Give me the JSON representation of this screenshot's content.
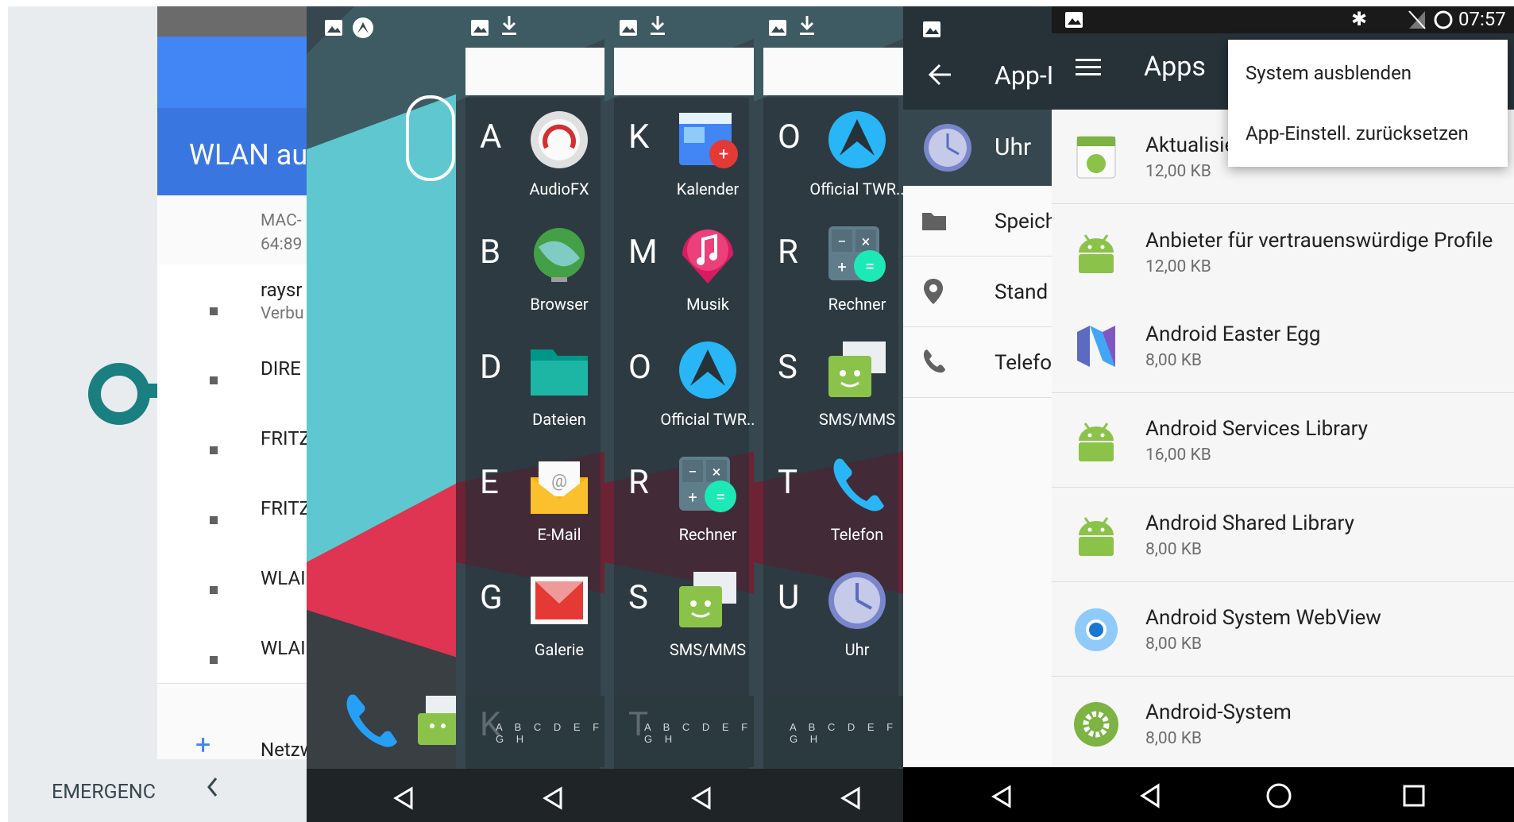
{
  "status_bar": {
    "time": "07:57"
  },
  "lock_panel": {
    "emergency": "EMERGENC",
    "wlan_title": "WLAN au",
    "mac_line1": "MAC-",
    "mac_line2": "64:89",
    "networks": [
      {
        "name": "raysr",
        "sub": "Verbu"
      },
      {
        "name": "DIRE",
        "sub": ""
      },
      {
        "name": "FRITZ",
        "sub": ""
      },
      {
        "name": "FRITZ",
        "sub": ""
      },
      {
        "name": "WLAI",
        "sub": ""
      },
      {
        "name": "WLAI",
        "sub": ""
      }
    ],
    "add_network": "Netzw"
  },
  "drawer_a": {
    "apps": [
      {
        "letter": "A",
        "name": "AudioFX"
      },
      {
        "letter": "B",
        "name": "Browser"
      },
      {
        "letter": "D",
        "name": "Dateien"
      },
      {
        "letter": "E",
        "name": "E-Mail"
      },
      {
        "letter": "G",
        "name": "Galerie"
      }
    ],
    "faded_letter": "K",
    "index": "A B C D E F G H"
  },
  "drawer_b": {
    "apps": [
      {
        "letter": "K",
        "name": "Kalender"
      },
      {
        "letter": "M",
        "name": "Musik"
      },
      {
        "letter": "O",
        "name": "Official TWR.."
      },
      {
        "letter": "R",
        "name": "Rechner"
      },
      {
        "letter": "S",
        "name": "SMS/MMS"
      }
    ],
    "faded_letter": "T",
    "index": "A B C D E F G H"
  },
  "drawer_c": {
    "apps": [
      {
        "letter": "O",
        "name": "Official TWR.."
      },
      {
        "letter": "R",
        "name": "Rechner"
      },
      {
        "letter": "S",
        "name": "SMS/MMS"
      },
      {
        "letter": "T",
        "name": "Telefon"
      },
      {
        "letter": "U",
        "name": "Uhr"
      }
    ],
    "index": "A B C D E F G H"
  },
  "app_info": {
    "title": "App-I",
    "app_name": "Uhr",
    "items": [
      "Speich",
      "Stand",
      "Telefo"
    ]
  },
  "apps_screen": {
    "title": "Apps",
    "menu": [
      "System ausblenden",
      "App-Einstell. zurücksetzen"
    ],
    "apps": [
      {
        "name": "Aktualisie",
        "size": "12,00 KB",
        "icon": "android-package-icon"
      },
      {
        "name": "Anbieter für vertrauenswürdige Profile",
        "size": "12,00 KB",
        "icon": "android-robot-icon"
      },
      {
        "name": "Android Easter Egg",
        "size": "8,00 KB",
        "icon": "nougat-n-icon"
      },
      {
        "name": "Android Services Library",
        "size": "16,00 KB",
        "icon": "android-robot-icon"
      },
      {
        "name": "Android Shared Library",
        "size": "8,00 KB",
        "icon": "android-robot-icon"
      },
      {
        "name": "Android System WebView",
        "size": "8,00 KB",
        "icon": "chromium-icon"
      },
      {
        "name": "Android-System",
        "size": "8,00 KB",
        "icon": "settings-gear-icon"
      }
    ]
  },
  "colors": {
    "teal": "#1a7f80",
    "blue": "#4285f4",
    "dark": "#263238",
    "drawer_bg": "#2b3a3f",
    "android_green": "#8bc34a"
  }
}
